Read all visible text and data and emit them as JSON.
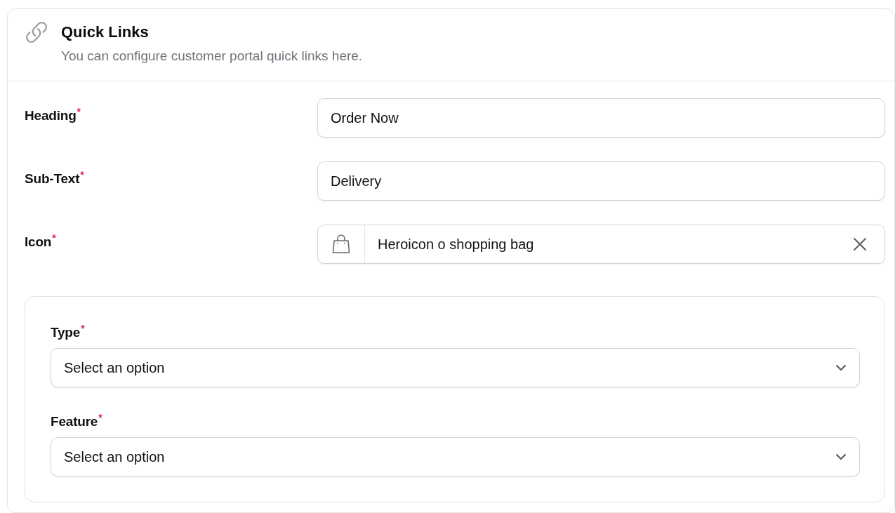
{
  "section": {
    "title": "Quick Links",
    "description": "You can configure customer portal quick links here."
  },
  "fields": [
    {
      "kind": "text",
      "label": "Heading",
      "required_mark": "*",
      "value": "Order Now"
    },
    {
      "kind": "text",
      "label": "Sub-Text",
      "required_mark": "*",
      "value": "Delivery"
    },
    {
      "kind": "icon-picker",
      "label": "Icon",
      "required_mark": "*",
      "value": "Heroicon o shopping bag"
    }
  ],
  "link_panel": {
    "fields": [
      {
        "kind": "select",
        "label": "Type",
        "required_mark": "*",
        "placeholder": "Select an option"
      },
      {
        "kind": "select",
        "label": "Feature",
        "required_mark": "*",
        "placeholder": "Select an option"
      }
    ]
  }
}
